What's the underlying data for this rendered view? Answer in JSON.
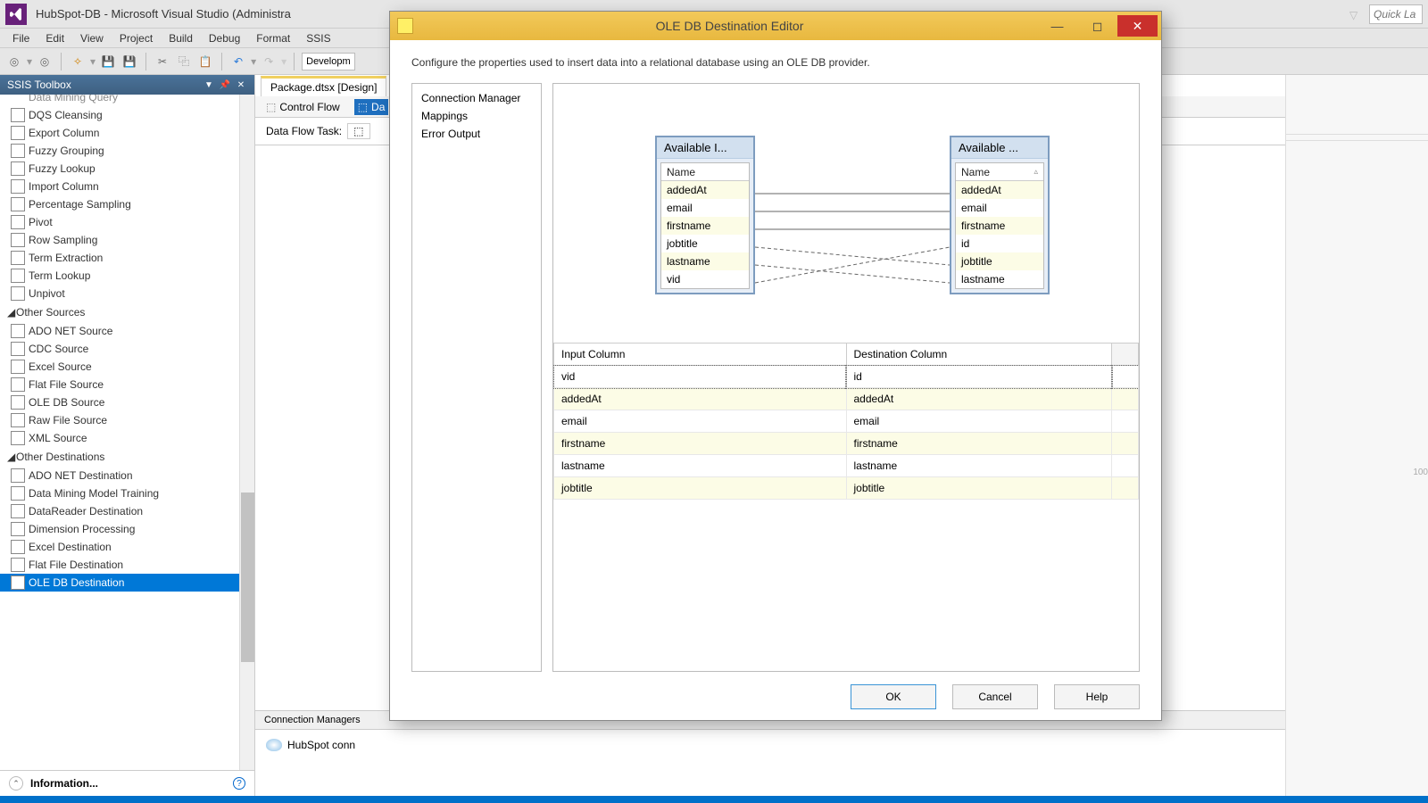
{
  "vs": {
    "title": "HubSpot-DB - Microsoft Visual Studio (Administra",
    "quick_launch_placeholder": "Quick La"
  },
  "menu": [
    "File",
    "Edit",
    "View",
    "Project",
    "Build",
    "Debug",
    "Format",
    "SSIS"
  ],
  "toolbar_combo": "Developm",
  "toolbox": {
    "title": "SSIS Toolbox",
    "top_cut": "Data Mining Query",
    "items1": [
      "DQS Cleansing",
      "Export Column",
      "Fuzzy Grouping",
      "Fuzzy Lookup",
      "Import Column",
      "Percentage Sampling",
      "Pivot",
      "Row Sampling",
      "Term Extraction",
      "Term Lookup",
      "Unpivot"
    ],
    "group_sources": "Other Sources",
    "sources": [
      "ADO NET Source",
      "CDC Source",
      "Excel Source",
      "Flat File Source",
      "OLE DB Source",
      "Raw File Source",
      "XML Source"
    ],
    "group_dest": "Other Destinations",
    "destinations": [
      "ADO NET Destination",
      "Data Mining Model Training",
      "DataReader Destination",
      "Dimension Processing",
      "Excel Destination",
      "Flat File Destination",
      "OLE DB Destination"
    ],
    "info": "Information..."
  },
  "designer": {
    "tab": "Package.dtsx [Design]",
    "sub_control": "Control Flow",
    "sub_data": "Da",
    "dft": "Data Flow Task:",
    "conn_title": "Connection Managers",
    "conn_name": "HubSpot conn"
  },
  "dialog": {
    "title": "OLE DB Destination Editor",
    "desc": "Configure the properties used to insert data into a relational database using an OLE DB provider.",
    "nav": [
      "Connection Manager",
      "Mappings",
      "Error Output"
    ],
    "avail_in_title": "Available I...",
    "avail_out_title": "Available ...",
    "name_hdr": "Name",
    "input_cols": [
      "addedAt",
      "email",
      "firstname",
      "jobtitle",
      "lastname",
      "vid"
    ],
    "output_cols": [
      "addedAt",
      "email",
      "firstname",
      "id",
      "jobtitle",
      "lastname"
    ],
    "grid_headers": [
      "Input Column",
      "Destination Column"
    ],
    "grid_rows": [
      {
        "in": "vid",
        "out": "id"
      },
      {
        "in": "addedAt",
        "out": "addedAt"
      },
      {
        "in": "email",
        "out": "email"
      },
      {
        "in": "firstname",
        "out": "firstname"
      },
      {
        "in": "lastname",
        "out": "lastname"
      },
      {
        "in": "jobtitle",
        "out": "jobtitle"
      }
    ],
    "btn_ok": "OK",
    "btn_cancel": "Cancel",
    "btn_help": "Help"
  },
  "right_tick": "100"
}
